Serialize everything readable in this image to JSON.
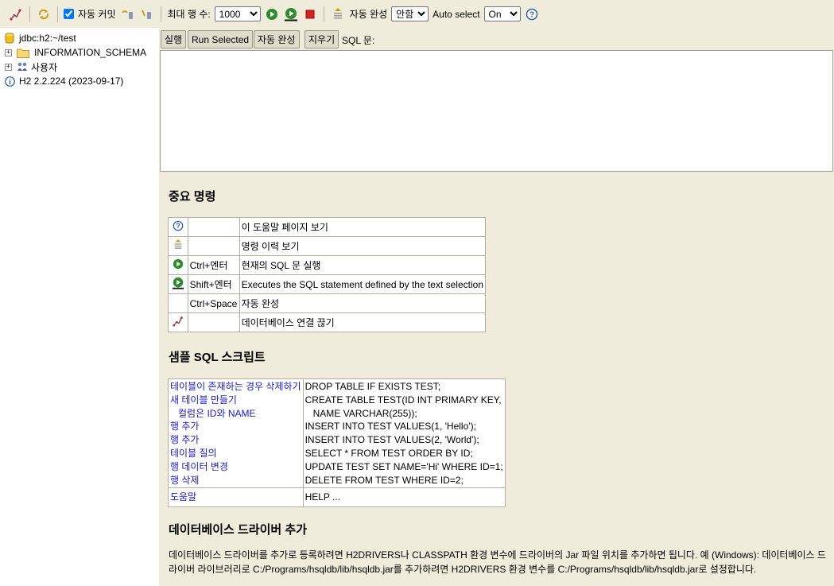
{
  "toolbar": {
    "auto_commit_label": "자동 커밋",
    "max_rows_label": "최대 행 수:",
    "max_rows_value": "1000",
    "auto_complete_label": "자동 완성",
    "auto_complete_value": "안함",
    "auto_select_label": "Auto select",
    "auto_select_value": "On"
  },
  "tree": {
    "connection": "jdbc:h2:~/test",
    "schema": "INFORMATION_SCHEMA",
    "users": "사용자",
    "version": "H2 2.2.224 (2023-09-17)"
  },
  "query": {
    "run_label": "실행",
    "run_selected_label": "Run Selected",
    "auto_complete_label": "자동 완성",
    "clear_label": "지우기",
    "sql_label": "SQL 문:"
  },
  "important": {
    "title": "중요 명령",
    "rows": [
      {
        "icon": "help-icon",
        "key": "",
        "desc": "이 도움말 페이지 보기"
      },
      {
        "icon": "history-icon",
        "key": "",
        "desc": "명령 이력 보기"
      },
      {
        "icon": "run-icon",
        "key": "Ctrl+엔터",
        "desc": "현재의 SQL 문 실행"
      },
      {
        "icon": "run-selected-icon",
        "key": "Shift+엔터",
        "desc": "Executes the SQL statement defined by the text selection"
      },
      {
        "icon": "",
        "key": "Ctrl+Space",
        "desc": "자동 완성"
      },
      {
        "icon": "disconnect-icon",
        "key": "",
        "desc": "데이터베이스 연결 끊기"
      }
    ]
  },
  "samples": {
    "title": "샘플 SQL 스크립트",
    "links": [
      "테이블이 존재하는 경우 삭제하기",
      "새 테이블 만들기",
      "  컬럼은 ID와 NAME",
      "행 추가",
      "행 추가",
      "테이블 질의",
      "행 데이터 변경",
      "행 삭제"
    ],
    "code": [
      "DROP TABLE IF EXISTS TEST;",
      "CREATE TABLE TEST(ID INT PRIMARY KEY,",
      "   NAME VARCHAR(255));",
      "INSERT INTO TEST VALUES(1, 'Hello');",
      "INSERT INTO TEST VALUES(2, 'World');",
      "SELECT * FROM TEST ORDER BY ID;",
      "UPDATE TEST SET NAME='Hi' WHERE ID=1;",
      "DELETE FROM TEST WHERE ID=2;"
    ],
    "help_link": "도움말",
    "help_code": "HELP ..."
  },
  "driver": {
    "title": "데이터베이스 드라이버 추가",
    "text": "데이터베이스 드라이버를 추가로 등록하려면 H2DRIVERS나 CLASSPATH 환경 변수에 드라이버의 Jar 파일 위치를 추가하면 됩니다. 예 (Windows): 데이터베이스 드라이버 라이브러리로 C:/Programs/hsqldb/lib/hsqldb.jar를 추가하려면 H2DRIVERS 환경 변수를 C:/Programs/hsqldb/lib/hsqldb.jar로 설정합니다."
  },
  "colors": {
    "background": "#f0ecdc",
    "link": "#1a1ad4",
    "run_green": "#2e8b2e",
    "stop_red": "#d42020"
  }
}
